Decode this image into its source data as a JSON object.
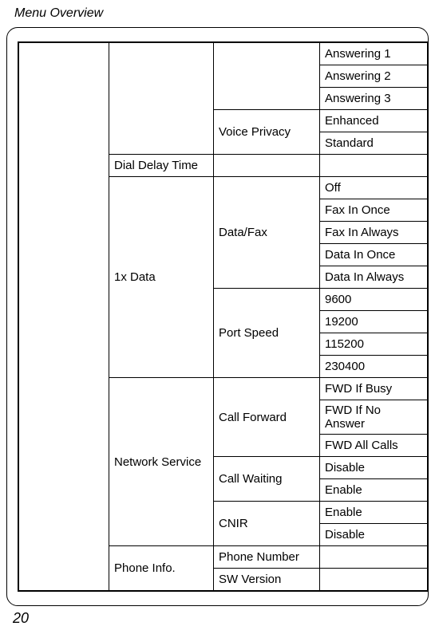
{
  "header": {
    "title": "Menu Overview"
  },
  "page_number": "20",
  "rows": {
    "answering1": "Answering 1",
    "answering2": "Answering 2",
    "answering3": "Answering 3",
    "voice_privacy": "Voice Privacy",
    "vp_enhanced": "Enhanced",
    "vp_standard": "Standard",
    "dial_delay": "Dial Delay Time",
    "onex_data": "1x Data",
    "data_fax": "Data/Fax",
    "df_off": "Off",
    "df_fax_once": "Fax In Once",
    "df_fax_always": "Fax In Always",
    "df_data_once": "Data In Once",
    "df_data_always": "Data In Always",
    "port_speed": "Port Speed",
    "ps_9600": "9600",
    "ps_19200": "19200",
    "ps_115200": "115200",
    "ps_230400": "230400",
    "network_service": "Network Service",
    "call_forward": "Call Forward",
    "cf_busy": "FWD If Busy",
    "cf_noans": "FWD If No Answer",
    "cf_all": "FWD All Calls",
    "call_waiting": "Call Waiting",
    "cw_disable": "Disable",
    "cw_enable": "Enable",
    "cnir": "CNIR",
    "cnir_enable": "Enable",
    "cnir_disable": "Disable",
    "phone_info": "Phone Info.",
    "phone_number": "Phone Number",
    "sw_version": "SW Version"
  }
}
